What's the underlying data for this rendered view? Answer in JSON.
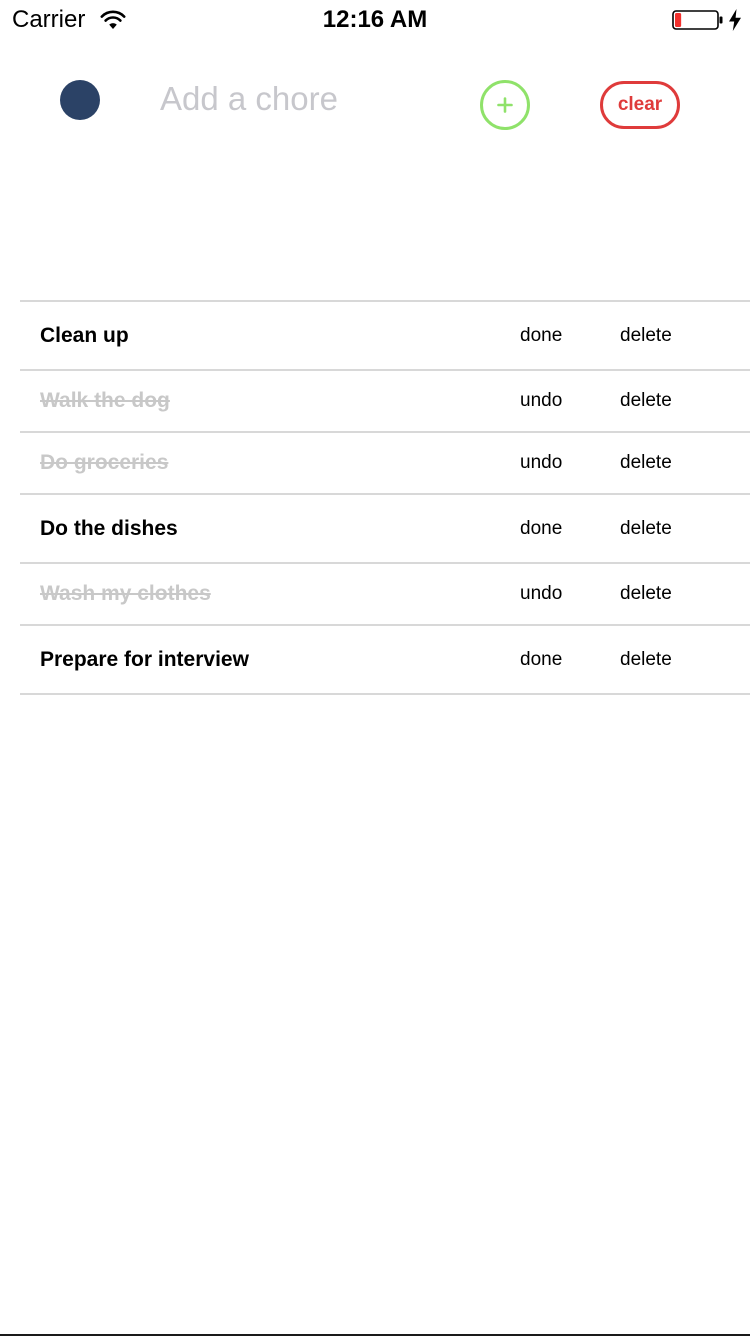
{
  "status_bar": {
    "carrier": "Carrier",
    "time": "12:16 AM",
    "battery_level": 0.15,
    "battery_color": "#f2302d"
  },
  "header": {
    "avatar_color": "#2b4266",
    "input_placeholder": "Add a chore",
    "input_value": "",
    "add_icon": "plus-icon",
    "add_color": "#8fe26a",
    "clear_label": "clear",
    "clear_color": "#df3b3b"
  },
  "chores": [
    {
      "title": "Clean up",
      "completed": false,
      "toggle_label": "done",
      "delete_label": "delete"
    },
    {
      "title": "Walk the dog",
      "completed": true,
      "toggle_label": "undo",
      "delete_label": "delete"
    },
    {
      "title": "Do groceries",
      "completed": true,
      "toggle_label": "undo",
      "delete_label": "delete"
    },
    {
      "title": "Do the dishes",
      "completed": false,
      "toggle_label": "done",
      "delete_label": "delete"
    },
    {
      "title": "Wash my clothes",
      "completed": true,
      "toggle_label": "undo",
      "delete_label": "delete"
    },
    {
      "title": "Prepare for interview",
      "completed": false,
      "toggle_label": "done",
      "delete_label": "delete"
    }
  ]
}
